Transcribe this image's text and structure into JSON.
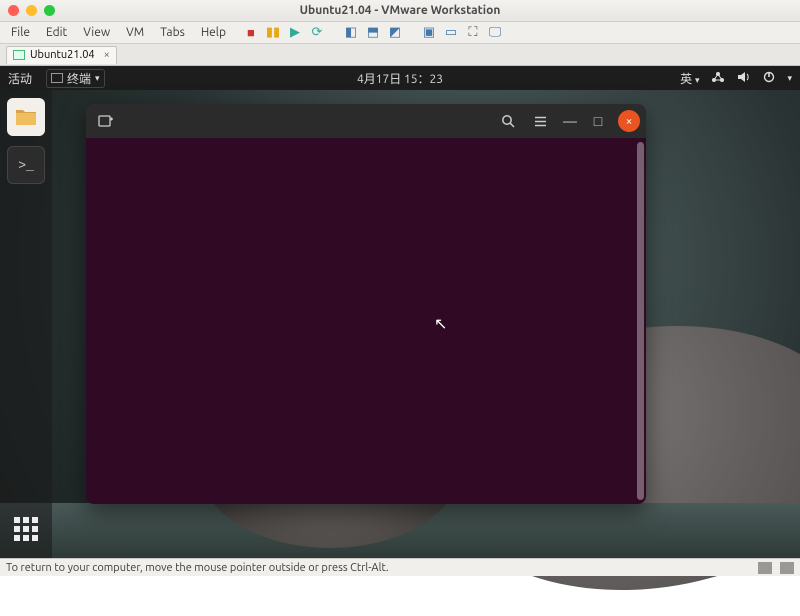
{
  "vmware": {
    "title": "Ubuntu21.04 - VMware Workstation",
    "menu": [
      "File",
      "Edit",
      "View",
      "VM",
      "Tabs",
      "Help"
    ],
    "tab_label": "Ubuntu21.04",
    "tab_close": "×",
    "status_text": "To return to your computer, move the mouse pointer outside or press Ctrl-Alt."
  },
  "ubuntu_topbar": {
    "activities": "活动",
    "window_title": "终端",
    "datetime": "4月17日  15：23",
    "ime": "英"
  },
  "terminal": {
    "minimize": "—",
    "maximize": "□",
    "close": "×"
  },
  "colors": {
    "accent": "#e95420",
    "terminal_bg": "#300a24",
    "topbar_bg": "#1d1d1d"
  }
}
